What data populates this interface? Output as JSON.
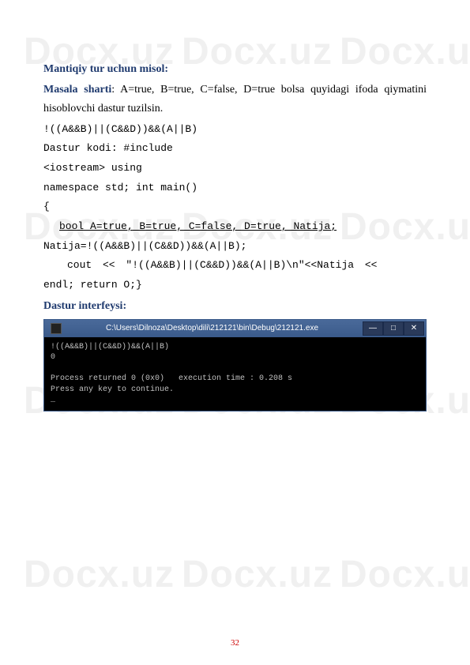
{
  "watermark": "Docx.uz",
  "heading1": "Mantiqiy tur uchun misol:",
  "masala_label": "Masala sharti",
  "masala_text": ": A=true, B=true, C=false, D=true bolsa quyidagi ifoda qiymatini hisoblovchi dastur tuzilsin.",
  "code": {
    "line1": "!((A&&B)||(C&&D))&&(A||B)",
    "line2": "Dastur kodi: #include",
    "line3": "<iostream> using",
    "line4": "namespace std; int main()",
    "line5": "{",
    "line6": "bool A=true, B=true, C=false, D=true, Natija;",
    "line7": "Natija=!((A&&B)||(C&&D))&&(A||B);",
    "line8": "cout << \"!((A&&B)||(C&&D))&&(A||B)\\n\"<<Natija <<",
    "line9": "endl;   return O;}"
  },
  "heading2": "Dastur interfeysi:",
  "console": {
    "title": "C:\\Users\\Dilnoza\\Desktop\\dili\\212121\\bin\\Debug\\212121.exe",
    "body": "!((A&&B)||(C&&D))&&(A||B)\n0\n\nProcess returned 0 (0x0)   execution time : 0.208 s\nPress any key to continue.\n_"
  },
  "page_number": "32",
  "controls": {
    "minimize": "—",
    "maximize": "□",
    "close": "✕"
  }
}
